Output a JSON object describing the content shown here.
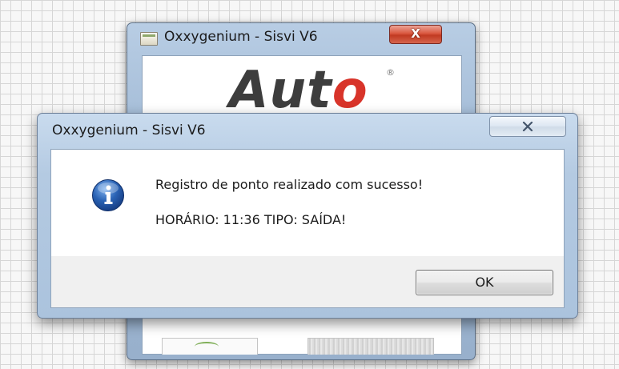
{
  "background_window": {
    "title": "Oxxygenium - Sisvi V6",
    "close_label": "X",
    "logo": {
      "text_main": "Aut",
      "text_accent": "o",
      "registered_mark": "®"
    },
    "icons": {
      "app": "app-window-icon"
    }
  },
  "dialog": {
    "title": "Oxxygenium - Sisvi V6",
    "icon": "info-icon",
    "message": "Registro de ponto realizado com sucesso!",
    "detail": "HORÁRIO: 11:36  TIPO: SAÍDA!",
    "ok_label": "OK",
    "close_icon": "close-icon"
  },
  "colors": {
    "logo_accent": "#d8342a",
    "titlebar": "#b4cae2",
    "close_button_red": "#c13a22",
    "info_icon_blue": "#2a63b5"
  }
}
